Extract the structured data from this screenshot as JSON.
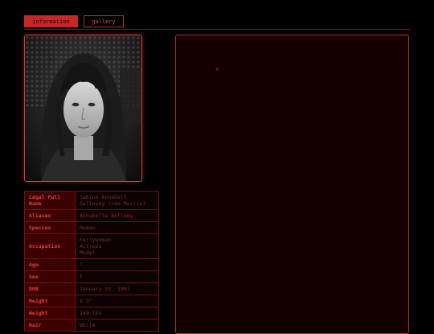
{
  "tabs": [
    {
      "label": "information",
      "active": true
    },
    {
      "label": "gallery",
      "active": false
    }
  ],
  "colors": {
    "accent": "#c62828",
    "border": "#d23a3a",
    "label_bg": "#3c0000",
    "value_text": "#7a3434"
  },
  "portrait": {
    "style": "grayscale"
  },
  "info": [
    {
      "key": "Legal Full Name",
      "value": [
        "Sabine Annabell",
        "Galloway (née Morris)"
      ]
    },
    {
      "key": "Aliases",
      "value": [
        "Annabelle Bellamy"
      ]
    },
    {
      "key": "Species",
      "value": [
        "Human"
      ]
    },
    {
      "key": "Occupation",
      "value": [
        "Ferrywoman",
        "Actress",
        "Model"
      ]
    },
    {
      "key": "Age",
      "value": [
        "?"
      ]
    },
    {
      "key": "Sex",
      "value": [
        "F"
      ]
    },
    {
      "key": "DOB",
      "value": [
        "January 23, 1901"
      ]
    },
    {
      "key": "Height",
      "value": [
        "6'3\""
      ]
    },
    {
      "key": "Weight",
      "value": [
        "149 lbs"
      ]
    },
    {
      "key": "Hair",
      "value": [
        "White"
      ]
    }
  ],
  "panel": {
    "close_glyph": "x"
  }
}
